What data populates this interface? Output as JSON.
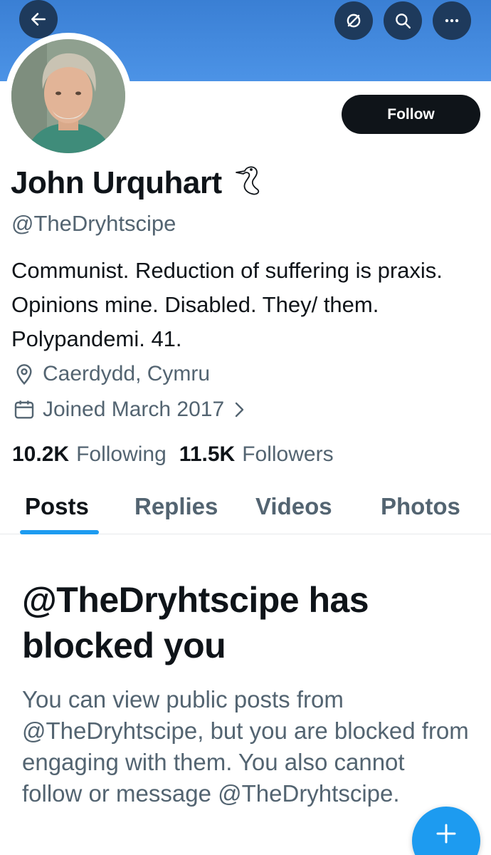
{
  "header": {
    "back_icon": "arrow-left-icon",
    "nostr_icon": "no-sign-icon",
    "search_icon": "search-icon",
    "more_icon": "more-horizontal-icon",
    "banner_color": "#4a8fe0"
  },
  "profile": {
    "display_name": "John Urquhart",
    "name_icon": "goose-icon",
    "handle": "@TheDryhtscipe",
    "bio": "Communist. Reduction of suffering is praxis. Opinions mine. Disabled. They/ them. Polypandemi. 41.",
    "location": "Caerdydd, Cymru",
    "joined": "Joined March 2017",
    "following_count": "10.2K",
    "following_label": "Following",
    "followers_count": "11.5K",
    "followers_label": "Followers"
  },
  "actions": {
    "follow_label": "Follow"
  },
  "tabs": [
    {
      "label": "Posts",
      "active": true
    },
    {
      "label": "Replies",
      "active": false
    },
    {
      "label": "Videos",
      "active": false
    },
    {
      "label": "Photos",
      "active": false
    }
  ],
  "blocked_notice": {
    "title": "@TheDryhtscipe has blocked you",
    "body": "You can view public posts from @TheDryhtscipe, but you are blocked from engaging with them. You also cannot follow or message @TheDryhtscipe."
  },
  "fab": {
    "icon": "plus-icon",
    "color": "#1d9bf0"
  }
}
